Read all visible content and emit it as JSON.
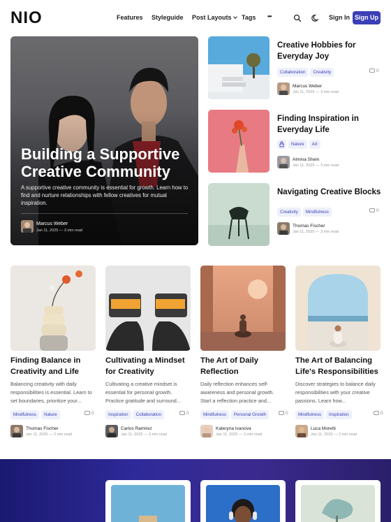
{
  "header": {
    "logo": "NIO",
    "nav": [
      {
        "label": "Features"
      },
      {
        "label": "Styleguide"
      },
      {
        "label": "Post Layouts"
      },
      {
        "label": "Tags"
      },
      {
        "label": "•••"
      }
    ],
    "signin": "Sign In",
    "signup": "Sign Up",
    "icons": [
      "search-icon",
      "moon-icon"
    ]
  },
  "hero": {
    "title": "Building a Supportive Creative Community",
    "excerpt": "A supportive creative community is essential for growth. Learn how to find and nurture relationships with fellow creatives for mutual inspiration.",
    "author": "Marcus Weber",
    "meta": "Jan 11, 2025 — 3 min read"
  },
  "side_posts": [
    {
      "title": "Creative Hobbies for Everyday Joy",
      "tags": [
        "Collaboration",
        "Creativity"
      ],
      "comments": "0",
      "author": "Marcus Weber",
      "meta": "Jan 11, 2025 — 3 min read"
    },
    {
      "title": "Finding Inspiration in Everyday Life",
      "tags": [
        "Nature",
        "Art"
      ],
      "locked": true,
      "author": "Almina Shein",
      "meta": "Jan 11, 2025 — 3 min read"
    },
    {
      "title": "Navigating Creative Blocks",
      "tags": [
        "Creativity",
        "Mindfulness"
      ],
      "comments": "0",
      "author": "Thomas Fischer",
      "meta": "Jan 11, 2025 — 3 min read"
    }
  ],
  "grid_posts": [
    {
      "title": "Finding Balance in Creativity and Life",
      "excerpt": "Balancing creativity with daily responsibilities is essential. Learn to set boundaries, prioritize your...",
      "tags": [
        "Mindfulness",
        "Nature"
      ],
      "comments": "0",
      "author": "Thomas Fischer",
      "meta": "Jan 11, 2025 — 2 min read"
    },
    {
      "title": "Cultivating a Mindset for Creativity",
      "excerpt": "Cultivating a creative mindset is essential for personal growth. Practice gratitude and surround...",
      "tags": [
        "Inspiration",
        "Collaboration"
      ],
      "comments": "0",
      "author": "Carlos Ramirez",
      "meta": "Jan 11, 2025 — 3 min read"
    },
    {
      "title": "The Art of Daily Reflection",
      "excerpt": "Daily reflection enhances self-awareness and personal growth. Start a reflection practice and...",
      "tags": [
        "Mindfulness",
        "Personal Growth"
      ],
      "comments": "0",
      "author": "Kateryna Ivanova",
      "meta": "Jan 11, 2025 — 2 min read"
    },
    {
      "title": "The Art of Balancing Life's Responsibilities",
      "excerpt": "Discover strategies to balance daily responsibilities with your creative passions. Learn how...",
      "tags": [
        "Mindfulness",
        "Inspiration"
      ],
      "comments": "0",
      "author": "Luca Moretti",
      "meta": "Jan 11, 2025 — 2 min read"
    }
  ],
  "colors": {
    "accent": "#3b3fb6",
    "tag_bg": "#eef0fb",
    "band": "#2f2a9a"
  }
}
